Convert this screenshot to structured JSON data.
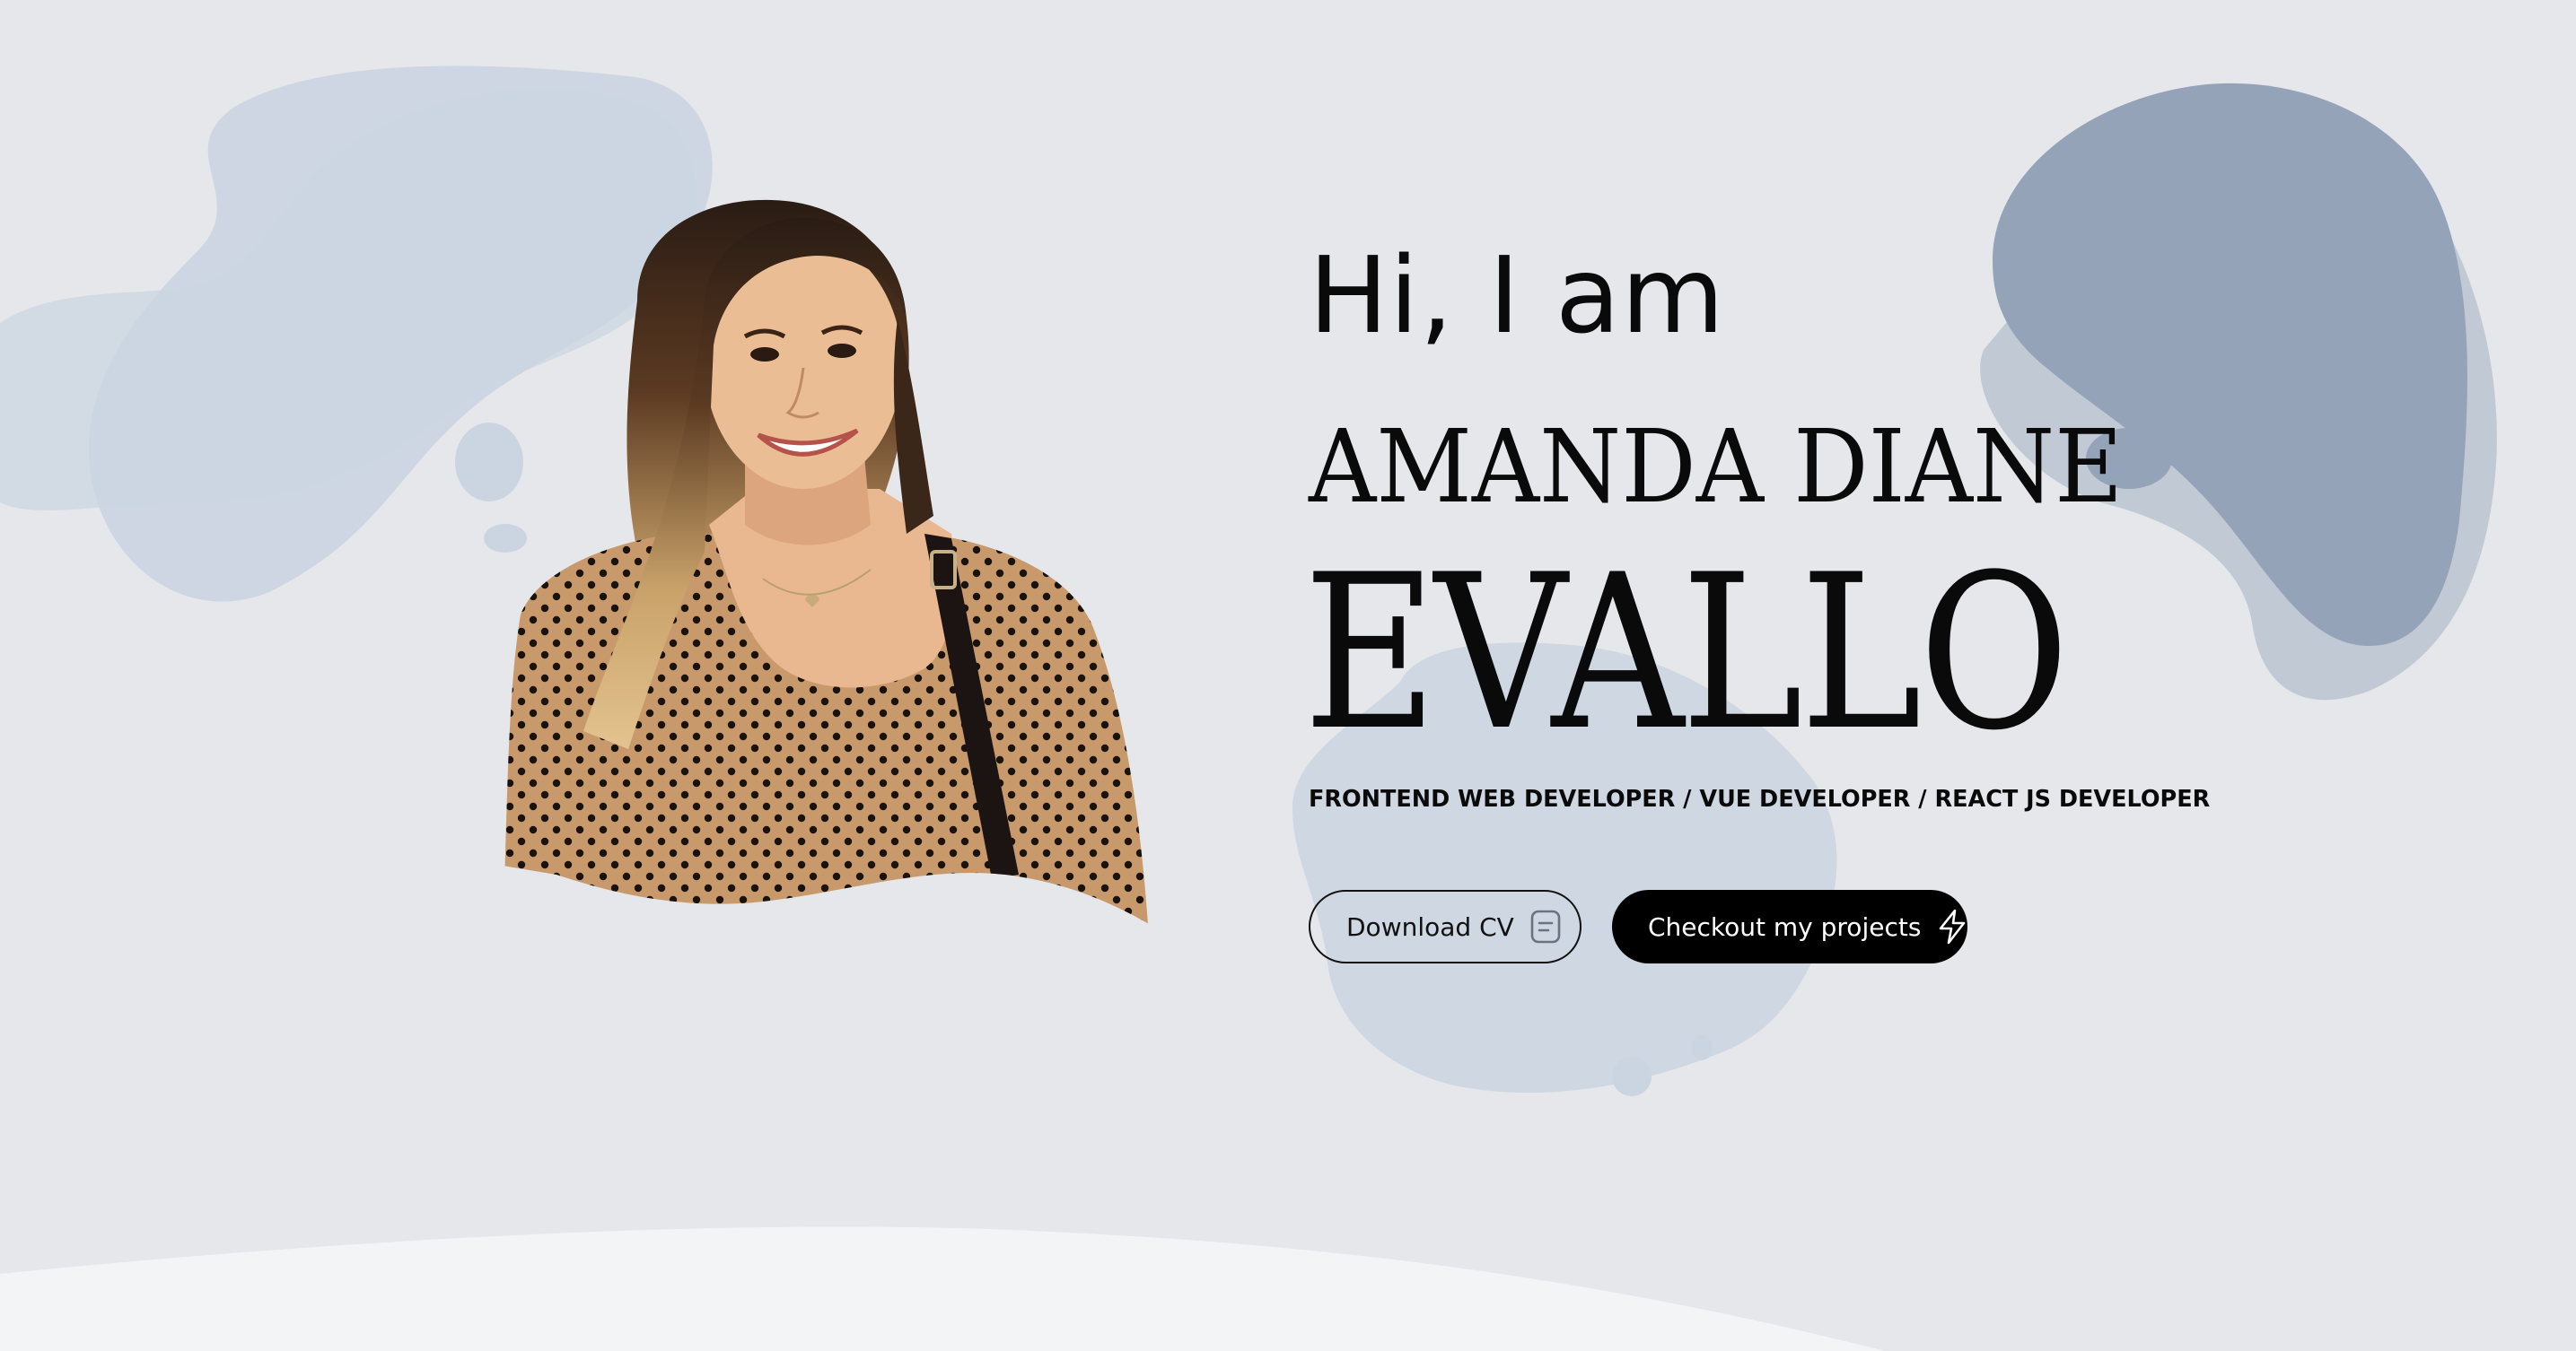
{
  "hero": {
    "greeting": "Hi, I am",
    "first_name": "AMANDA DIANE",
    "last_name": "EVALLO",
    "role": "FRONTEND WEB DEVELOPER / VUE DEVELOPER / REACT JS DEVELOPER",
    "download_cv_label": "Download CV",
    "download_cv_icon": "document-icon",
    "projects_label": "Checkout my projects",
    "projects_icon": "lightning-icon"
  },
  "colors": {
    "background": "#e5e7eb",
    "blob_light": "#cbd5e1",
    "blob_dark": "#94a3b8",
    "footer_wave": "#f3f4f6",
    "button_dark": "#000000",
    "text": "#0a0a0a"
  }
}
